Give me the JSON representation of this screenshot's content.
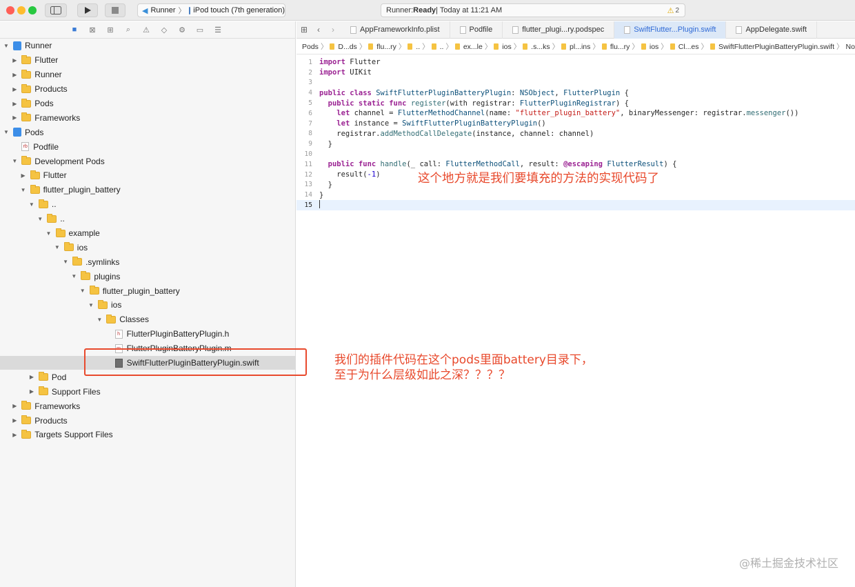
{
  "titlebar": {
    "scheme": "Runner",
    "device": "iPod touch (7th generation)",
    "status_prefix": "Runner: ",
    "status_state": "Ready",
    "status_time": " | Today at 11:21 AM",
    "warnings": "2"
  },
  "navigator": {
    "rows": [
      {
        "label": "Runner",
        "depth": 0,
        "icon": "project",
        "expanded": true
      },
      {
        "label": "Flutter",
        "depth": 1,
        "icon": "folder",
        "expanded": false
      },
      {
        "label": "Runner",
        "depth": 1,
        "icon": "folder",
        "expanded": false
      },
      {
        "label": "Products",
        "depth": 1,
        "icon": "folder",
        "expanded": false
      },
      {
        "label": "Pods",
        "depth": 1,
        "icon": "folder",
        "expanded": false
      },
      {
        "label": "Frameworks",
        "depth": 1,
        "icon": "folder",
        "expanded": false
      },
      {
        "label": "Pods",
        "depth": 0,
        "icon": "project",
        "expanded": true
      },
      {
        "label": "Podfile",
        "depth": 1,
        "icon": "rb",
        "expanded": null
      },
      {
        "label": "Development Pods",
        "depth": 1,
        "icon": "folder",
        "expanded": true
      },
      {
        "label": "Flutter",
        "depth": 2,
        "icon": "folder",
        "expanded": false
      },
      {
        "label": "flutter_plugin_battery",
        "depth": 2,
        "icon": "folder",
        "expanded": true
      },
      {
        "label": "..",
        "depth": 3,
        "icon": "folder",
        "expanded": true
      },
      {
        "label": "..",
        "depth": 4,
        "icon": "folder",
        "expanded": true
      },
      {
        "label": "example",
        "depth": 5,
        "icon": "folder",
        "expanded": true
      },
      {
        "label": "ios",
        "depth": 6,
        "icon": "folder",
        "expanded": true
      },
      {
        "label": ".symlinks",
        "depth": 7,
        "icon": "folder",
        "expanded": true
      },
      {
        "label": "plugins",
        "depth": 8,
        "icon": "folder",
        "expanded": true
      },
      {
        "label": "flutter_plugin_battery",
        "depth": 9,
        "icon": "folder",
        "expanded": true
      },
      {
        "label": "ios",
        "depth": 10,
        "icon": "folder",
        "expanded": true
      },
      {
        "label": "Classes",
        "depth": 11,
        "icon": "folder",
        "expanded": true
      },
      {
        "label": "FlutterPluginBatteryPlugin.h",
        "depth": 12,
        "icon": "h",
        "expanded": null
      },
      {
        "label": "FlutterPluginBatteryPlugin.m",
        "depth": 12,
        "icon": "m",
        "expanded": null
      },
      {
        "label": "SwiftFlutterPluginBatteryPlugin.swift",
        "depth": 12,
        "icon": "swift",
        "expanded": null,
        "selected": true
      },
      {
        "label": "Pod",
        "depth": 3,
        "icon": "folder",
        "expanded": false
      },
      {
        "label": "Support Files",
        "depth": 3,
        "icon": "folder",
        "expanded": false
      },
      {
        "label": "Frameworks",
        "depth": 1,
        "icon": "folder",
        "expanded": false
      },
      {
        "label": "Products",
        "depth": 1,
        "icon": "folder",
        "expanded": false
      },
      {
        "label": "Targets Support Files",
        "depth": 1,
        "icon": "folder",
        "expanded": false
      }
    ]
  },
  "tabs": [
    {
      "label": "AppFrameworkInfo.plist",
      "active": false
    },
    {
      "label": "Podfile",
      "active": false
    },
    {
      "label": "flutter_plugi...ry.podspec",
      "active": false
    },
    {
      "label": "SwiftFlutter...Plugin.swift",
      "active": true
    },
    {
      "label": "AppDelegate.swift",
      "active": false
    }
  ],
  "jumpbar": [
    "Pods",
    "D...ds",
    "flu...ry",
    "..",
    "..",
    "ex...le",
    "ios",
    ".s...ks",
    "pl...ins",
    "flu...ry",
    "ios",
    "Cl...es",
    "SwiftFlutterPluginBatteryPlugin.swift",
    "No"
  ],
  "code_lines": [
    "import Flutter",
    "import UIKit",
    "",
    "public class SwiftFlutterPluginBatteryPlugin: NSObject, FlutterPlugin {",
    "  public static func register(with registrar: FlutterPluginRegistrar) {",
    "    let channel = FlutterMethodChannel(name: \"flutter_plugin_battery\", binaryMessenger: registrar.messenger())",
    "    let instance = SwiftFlutterPluginBatteryPlugin()",
    "    registrar.addMethodCallDelegate(instance, channel: channel)",
    "  }",
    "",
    "  public func handle(_ call: FlutterMethodCall, result: @escaping FlutterResult) {",
    "    result(-1)",
    "  }",
    "}",
    ""
  ],
  "current_line": 15,
  "annotations": {
    "code_note": "这个地方就是我们要填充的方法的实现代码了",
    "tree_note_line1": "我们的插件代码在这个pods里面battery目录下，",
    "tree_note_line2": "至于为什么层级如此之深？？？？"
  },
  "watermark": "@稀土掘金技术社区",
  "colors": {
    "annotation": "#e8492c",
    "selection": "#dadada",
    "active_tab": "#2f6ad6"
  }
}
